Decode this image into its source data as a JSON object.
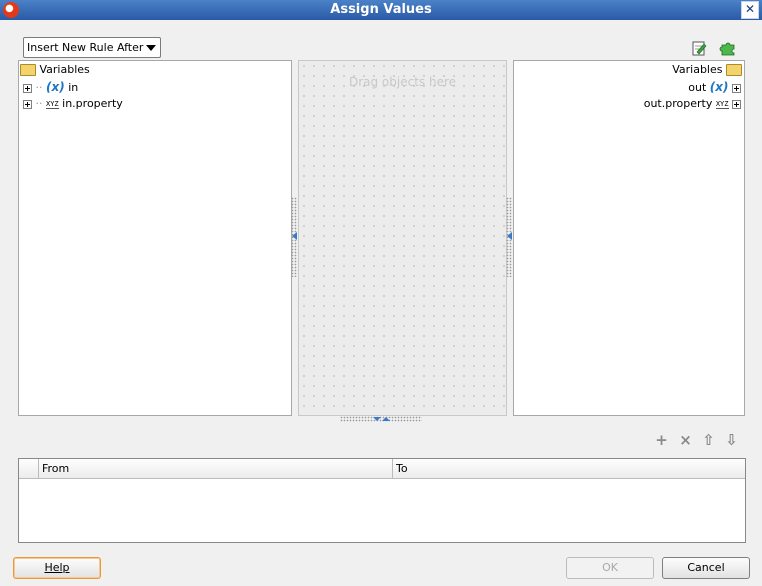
{
  "window": {
    "title": "Assign Values"
  },
  "toolbar": {
    "insert_mode": "Insert New Rule After"
  },
  "source_tree": {
    "root_label": "Variables",
    "items": [
      {
        "label": "in",
        "type": "variable"
      },
      {
        "label": "in.property",
        "type": "xml"
      }
    ]
  },
  "target_tree": {
    "root_label": "Variables",
    "items": [
      {
        "label": "out",
        "type": "variable"
      },
      {
        "label": "out.property",
        "type": "xml"
      }
    ]
  },
  "drag_area": {
    "hint": "Drag objects here"
  },
  "rules_table": {
    "columns": [
      "From",
      "To"
    ],
    "rows": []
  },
  "buttons": {
    "help": "Help",
    "ok": "OK",
    "cancel": "Cancel"
  },
  "icons": {
    "fx_glyph": "(x)",
    "xyz_glyph": "XYZ",
    "add": "+",
    "delete": "×",
    "up": "⇧",
    "down": "⇩"
  },
  "colors": {
    "title_bar": "#2a5aa6",
    "accent_blue": "#1f77c4",
    "help_focus": "#e89a3a"
  }
}
